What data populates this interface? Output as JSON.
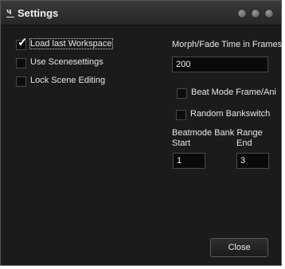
{
  "window": {
    "title": "Settings",
    "app_icon": "window-app-icon"
  },
  "left_options": [
    {
      "label": "Load last Workspace",
      "checked": true,
      "focused": true
    },
    {
      "label": "Use Scenesettings",
      "checked": false,
      "focused": false
    },
    {
      "label": "Lock Scene Editing",
      "checked": false,
      "focused": false
    }
  ],
  "morph": {
    "label": "Morph/Fade Time in Frames",
    "value": "200"
  },
  "right_options": [
    {
      "label": "Beat Mode Frame/Ani",
      "checked": false
    },
    {
      "label": "Random Bankswitch",
      "checked": false
    }
  ],
  "bank_range": {
    "label": "Beatmode Bank Range",
    "start_label": "Start",
    "end_label": "End",
    "start_value": "1",
    "end_value": "3"
  },
  "buttons": {
    "close_label": "Close"
  },
  "checkmark_glyph": "✓"
}
